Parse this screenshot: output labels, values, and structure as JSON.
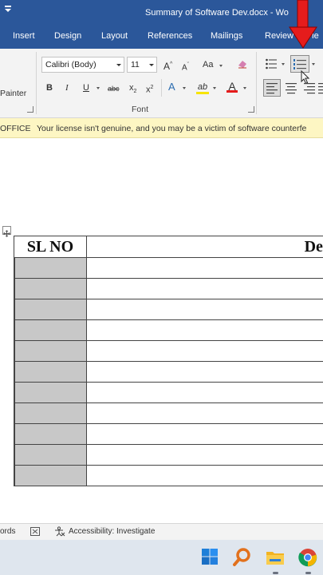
{
  "titlebar": {
    "doc_title": "Summary of Software Dev.docx  -  Wo"
  },
  "tabs": [
    "Insert",
    "Design",
    "Layout",
    "References",
    "Mailings",
    "Review",
    "Vie"
  ],
  "ribbon": {
    "clipboard": {
      "painter_label": "Painter"
    },
    "font": {
      "font_name": "Calibri (Body)",
      "font_size": "11",
      "group_label": "Font",
      "grow": "A",
      "shrink": "A",
      "change_case": "Aa",
      "bold": "B",
      "italic": "I",
      "underline": "U",
      "strikethrough": "abc",
      "subscript": "x",
      "superscript": "x",
      "text_effects": "A",
      "highlight": "ab",
      "font_color": "A"
    }
  },
  "message_bar": {
    "label": "OFFICE",
    "text": "Your license isn't genuine, and you may be a victim of software counterfe"
  },
  "document": {
    "table": {
      "headers": [
        "SL NO",
        "Descri"
      ],
      "row_count": 11
    }
  },
  "statusbar": {
    "words": "ords",
    "accessibility": "Accessibility: Investigate"
  },
  "taskbar": {
    "icons": [
      "windows-start",
      "search",
      "file-explorer",
      "chrome"
    ]
  },
  "colors": {
    "ribbon_blue": "#2b579a",
    "warning_yellow": "#fdf6c3",
    "annotation_red": "#e51c1c",
    "shaded_cell": "#c8c8c8"
  }
}
